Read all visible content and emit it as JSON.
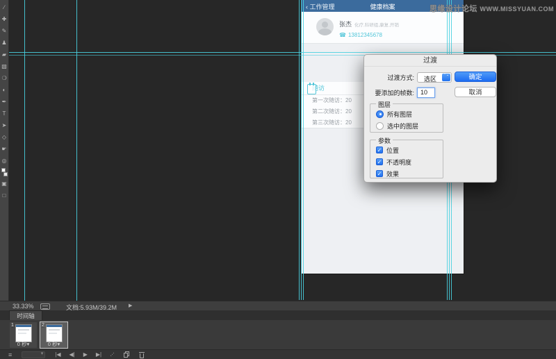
{
  "watermark": {
    "text_cn": "思缘设计论坛",
    "text_en": "WWW.MISSYUAN.COM"
  },
  "toolbar": {
    "tools": [
      {
        "name": "slice-tool",
        "glyph": "∕"
      },
      {
        "name": "spot-healing-brush-tool",
        "glyph": "✚"
      },
      {
        "name": "brush-tool",
        "glyph": "✎"
      },
      {
        "name": "clone-stamp-tool",
        "glyph": "♟"
      },
      {
        "name": "eraser-tool",
        "glyph": "▰"
      },
      {
        "name": "gradient-tool",
        "glyph": "▧"
      },
      {
        "name": "blur-tool",
        "glyph": "❍"
      },
      {
        "name": "dodge-tool",
        "glyph": "◐"
      },
      {
        "name": "pen-tool",
        "glyph": "✒"
      },
      {
        "name": "type-tool",
        "glyph": "T"
      },
      {
        "name": "path-selection-tool",
        "glyph": "➤"
      },
      {
        "name": "shape-tool",
        "glyph": "◇"
      },
      {
        "name": "hand-tool",
        "glyph": "☛"
      },
      {
        "name": "zoom-tool",
        "glyph": "◎"
      },
      {
        "name": "quick-mask-mode",
        "glyph": "▣"
      },
      {
        "name": "screen-mode",
        "glyph": "□"
      }
    ]
  },
  "mobile_mockup": {
    "nav": {
      "back_chevron": "‹",
      "back_label": "工作管理",
      "title": "健康档案"
    },
    "contact": {
      "name": "张杰",
      "tags": "化疗,科研组,康复,开销",
      "phone_icon": "☎",
      "phone": "13812345678"
    },
    "visits": {
      "section_title": "随访",
      "items": [
        {
          "label": "第一次随访：20"
        },
        {
          "label": "第二次随访：20"
        },
        {
          "label": "第三次随访：20"
        }
      ]
    }
  },
  "tween_dialog": {
    "title": "过渡",
    "tween_with_label": "过渡方式:",
    "tween_with_value": "选区",
    "stepper_glyphs": "⌃⌄",
    "frames_label": "要添加的帧数:",
    "frames_value": "10",
    "ok_label": "确定",
    "cancel_label": "取消",
    "layers_group": {
      "legend": "图层",
      "options": [
        {
          "label": "所有图层",
          "selected": true
        },
        {
          "label": "选中的图层",
          "selected": false
        }
      ]
    },
    "params_group": {
      "legend": "参数",
      "check_glyph": "✓",
      "options": [
        {
          "label": "位置",
          "checked": true
        },
        {
          "label": "不透明度",
          "checked": true
        },
        {
          "label": "效果",
          "checked": true
        }
      ]
    }
  },
  "status_bar": {
    "zoom_level": "33.33%",
    "doc_info": "文档:5.93M/39.2M",
    "expand_arrow": "▶"
  },
  "timeline": {
    "tab_label": "时间轴",
    "frames": [
      {
        "number": "1",
        "delay": "0 秒",
        "delay_arrow": "▾",
        "selected": false
      },
      {
        "number": "2",
        "delay": "0 秒",
        "delay_arrow": "▾",
        "selected": true
      }
    ],
    "controls": {
      "convert_glyph": "≡",
      "first_frame_glyph": "|◀",
      "prev_frame_glyph": "◀|",
      "play_glyph": "▶",
      "next_frame_glyph": "▶|",
      "tween_glyph": "⋯"
    }
  },
  "colors": {
    "accent_blue": "#2f7cf6",
    "guide_cyan": "#49d0e0",
    "mobile_header_blue": "#3b6b9d",
    "mobile_accent_cyan": "#53c6d9",
    "chrome_dark": "#3a3a3a",
    "canvas_dark": "#272727"
  }
}
